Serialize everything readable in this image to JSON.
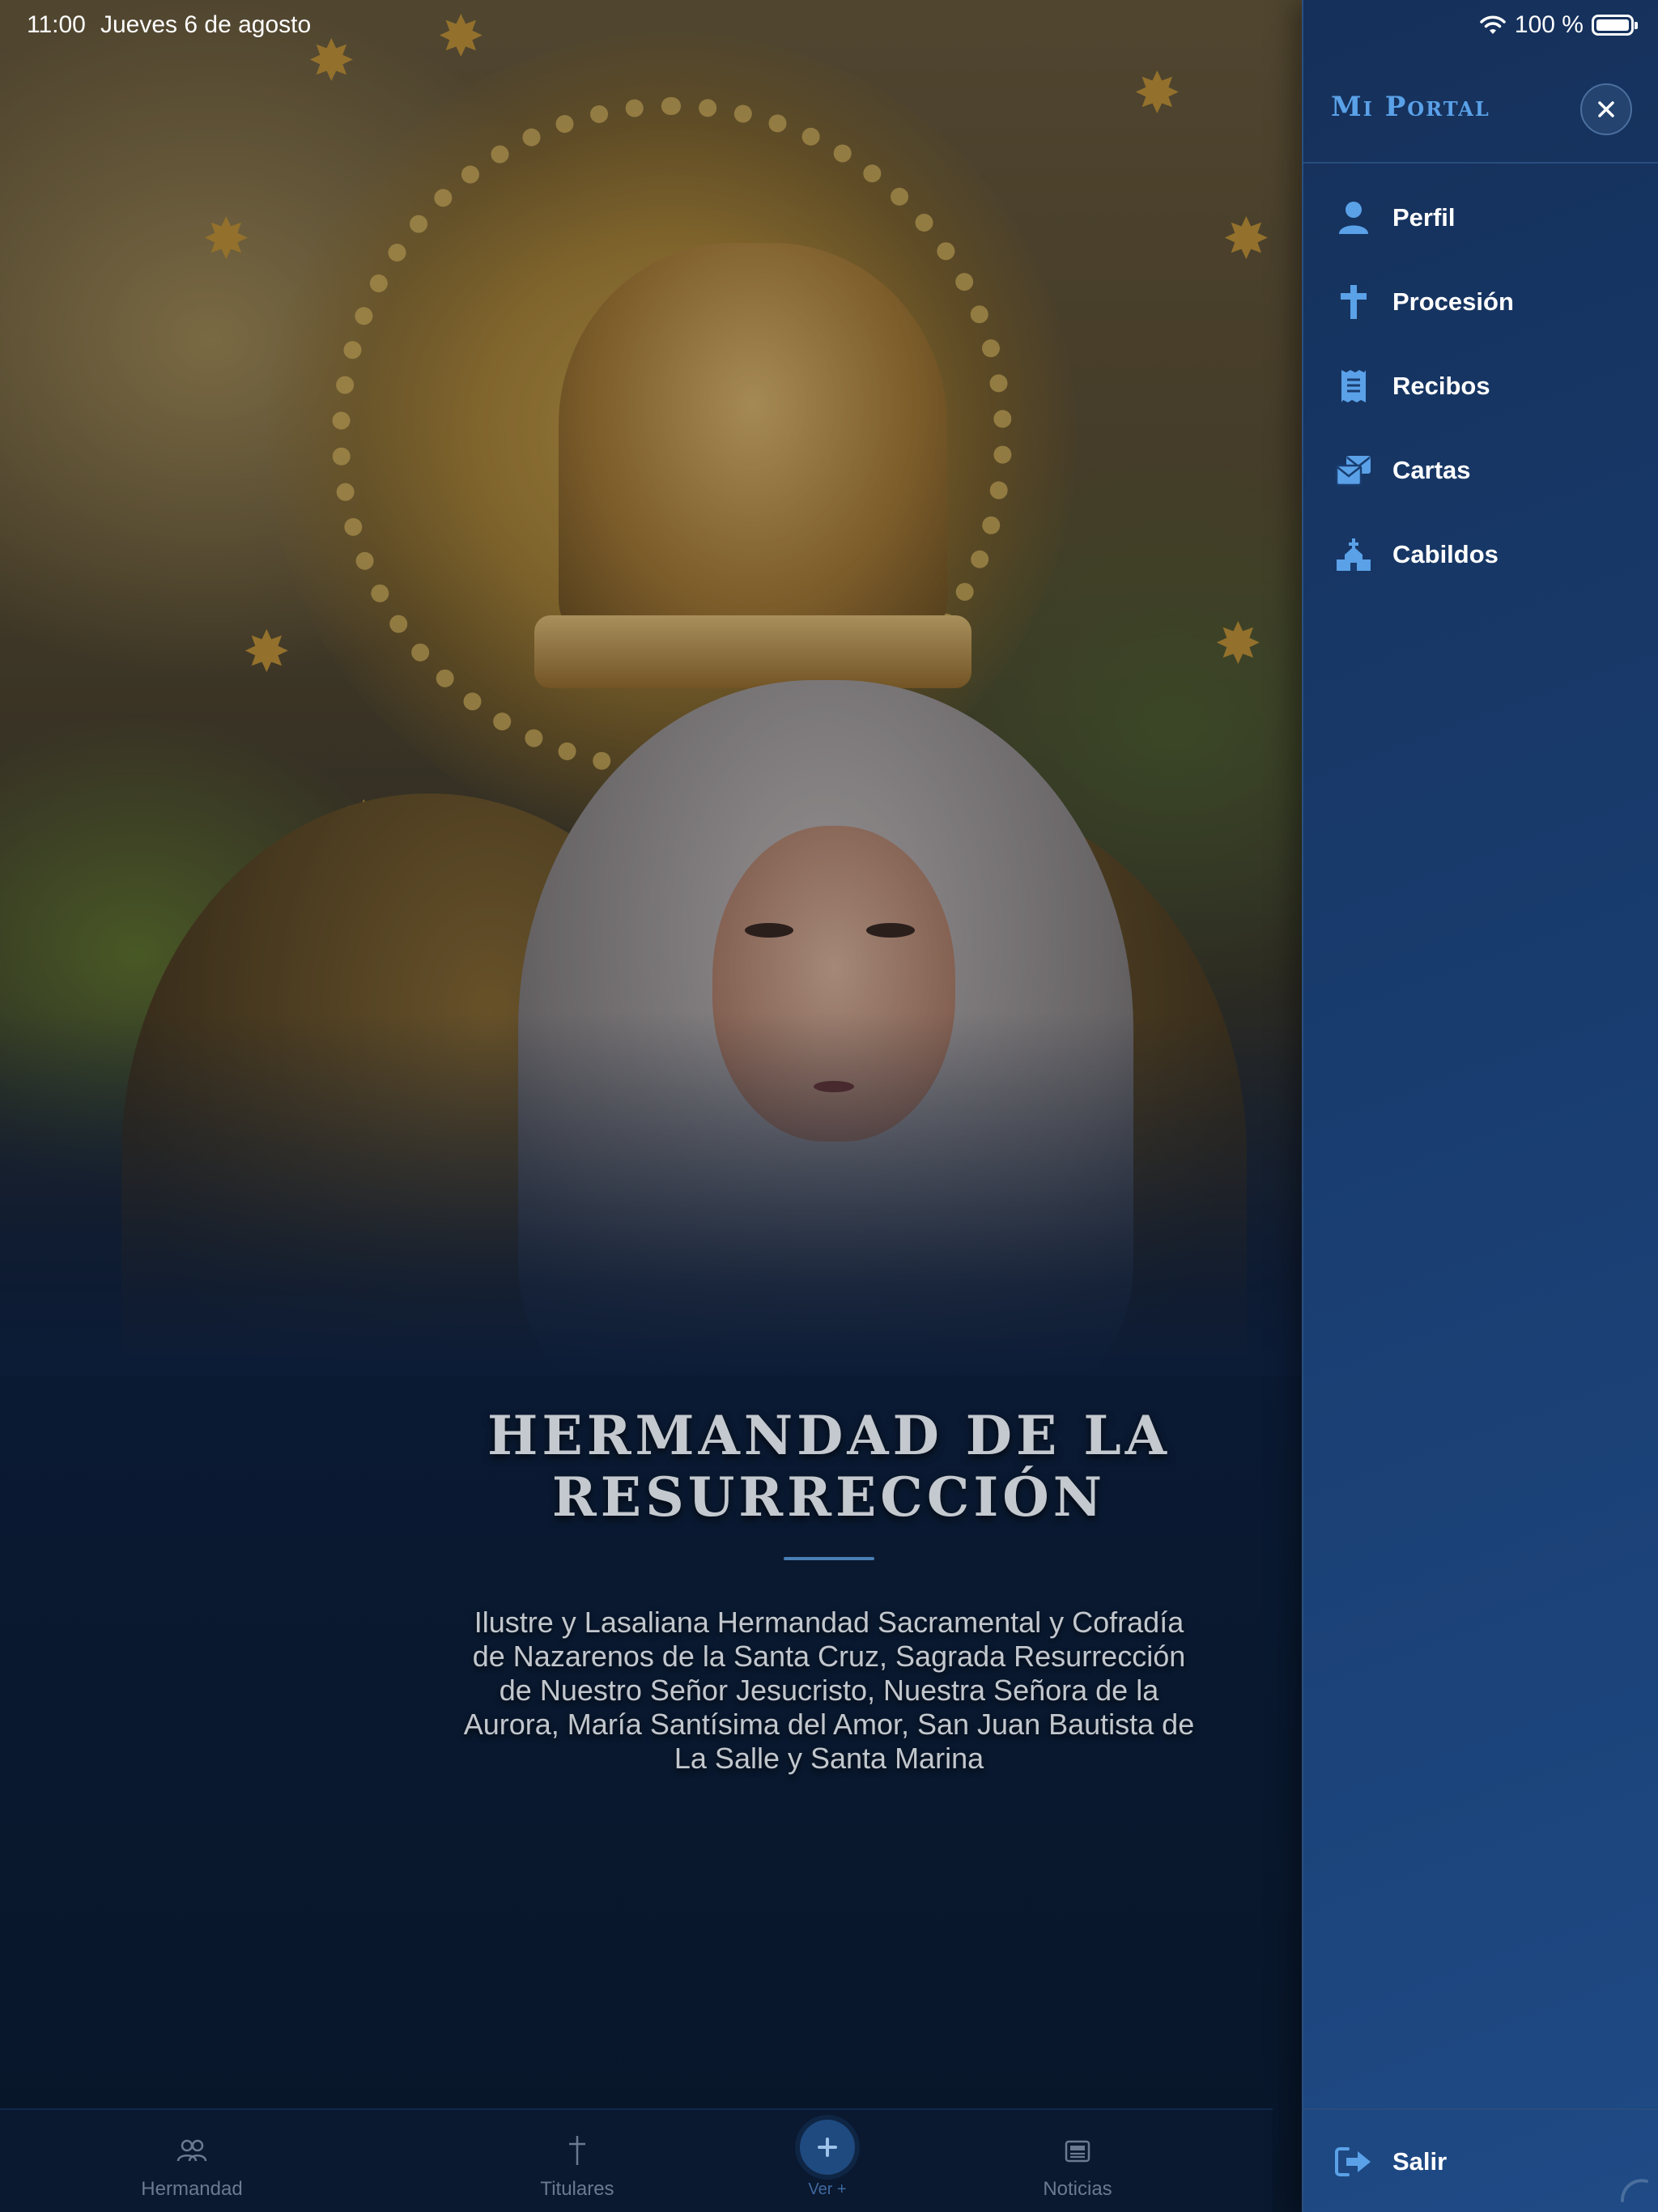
{
  "status_bar": {
    "time": "11:00",
    "date": "Jueves 6 de agosto",
    "battery_percent": "100 %",
    "battery_level": 1.0,
    "icons": [
      "wifi-icon",
      "battery-icon"
    ]
  },
  "hero": {
    "title": "HERMANDAD DE LA RESURRECCIÓN",
    "subtitle": "Ilustre y Lasaliana Hermandad Sacramental y Cofradía de Nazarenos de la Santa Cruz, Sagrada Resurrección de Nuestro Señor Jesucristo, Nuestra Señora de la Aurora, María Santísima del Amor, San Juan Bautista de La Salle y Santa Marina"
  },
  "tab_bar": {
    "tabs": [
      {
        "label": "Hermandad",
        "icon": "people-icon"
      },
      {
        "label": "Titulares",
        "icon": "cross-icon"
      },
      {
        "label": "Ver +",
        "icon": "plus-icon"
      },
      {
        "label": "Noticias",
        "icon": "newspaper-icon"
      }
    ]
  },
  "drawer": {
    "title": "Mi Portal",
    "close_icon": "close-icon",
    "items": [
      {
        "label": "Perfil",
        "icon": "user-icon"
      },
      {
        "label": "Procesión",
        "icon": "cross-icon"
      },
      {
        "label": "Recibos",
        "icon": "receipt-icon"
      },
      {
        "label": "Cartas",
        "icon": "mail-icon"
      },
      {
        "label": "Cabildos",
        "icon": "church-icon"
      }
    ],
    "logout_label": "Salir",
    "logout_icon": "logout-icon"
  },
  "colors": {
    "accent": "#5aa1e8",
    "drawer_bg": "#193d70",
    "main_bg": "#0b1a33",
    "tab_inactive": "#6b7a90"
  }
}
